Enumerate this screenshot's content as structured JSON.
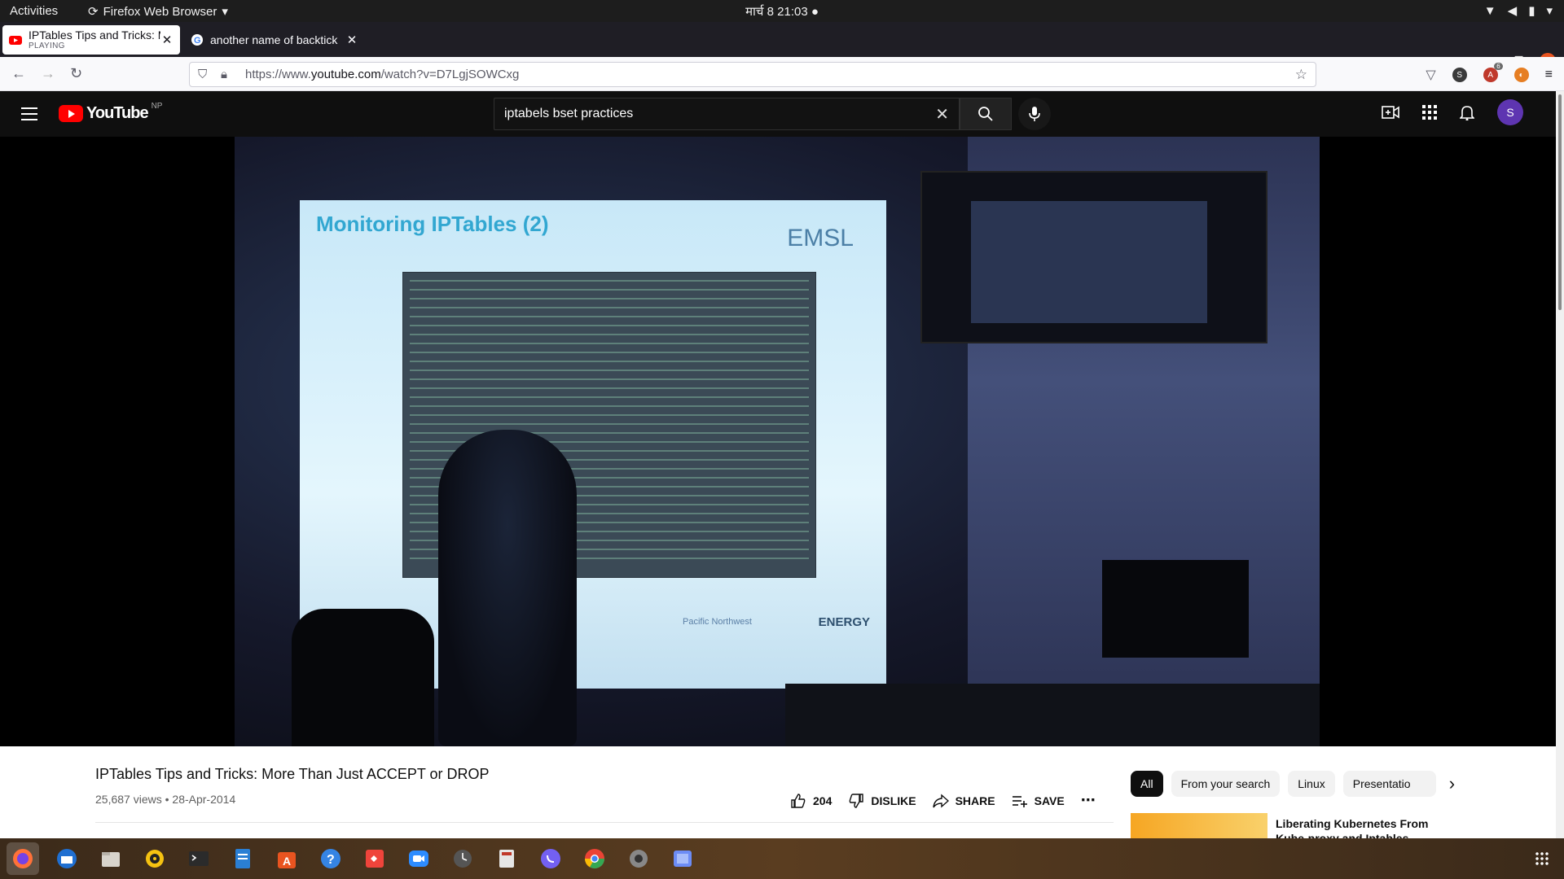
{
  "system": {
    "activities": "Activities",
    "app_menu": "Firefox Web Browser",
    "clock": "मार्च 8  21:03"
  },
  "browser": {
    "tabs": [
      {
        "title": "IPTables Tips and Tricks: M",
        "subtitle": "PLAYING",
        "active": true
      },
      {
        "title": "another name of backtick",
        "active": false
      }
    ],
    "url_prefix": "https://www.",
    "url_domain": "youtube.com",
    "url_path": "/watch?v=D7LgjSOWCxg",
    "extension_badge": "6"
  },
  "youtube": {
    "logo": "YouTube",
    "country": "NP",
    "search_query": "iptabels bset practices",
    "avatar_letter": "S"
  },
  "video_frame": {
    "slide_title": "Monitoring IPTables (2)",
    "slide_logo": "EMSL",
    "slide_footer_left": "Pacific Northwest",
    "slide_footer_right": "ENERGY"
  },
  "video": {
    "title": "IPTables Tips and Tricks: More Than Just ACCEPT or DROP",
    "views": "25,687 views",
    "date": "28-Apr-2014",
    "likes": "204",
    "dislike_label": "DISLIKE",
    "share_label": "SHARE",
    "save_label": "SAVE"
  },
  "chips": [
    "All",
    "From your search",
    "Linux",
    "Presentatio"
  ],
  "recommendation": {
    "title": "Liberating Kubernetes From Kube-proxy and Iptables"
  },
  "colors": {
    "yt_dark": "#0f0f0f",
    "yt_red": "#ff0000",
    "ubuntu_orange": "#e95420"
  }
}
